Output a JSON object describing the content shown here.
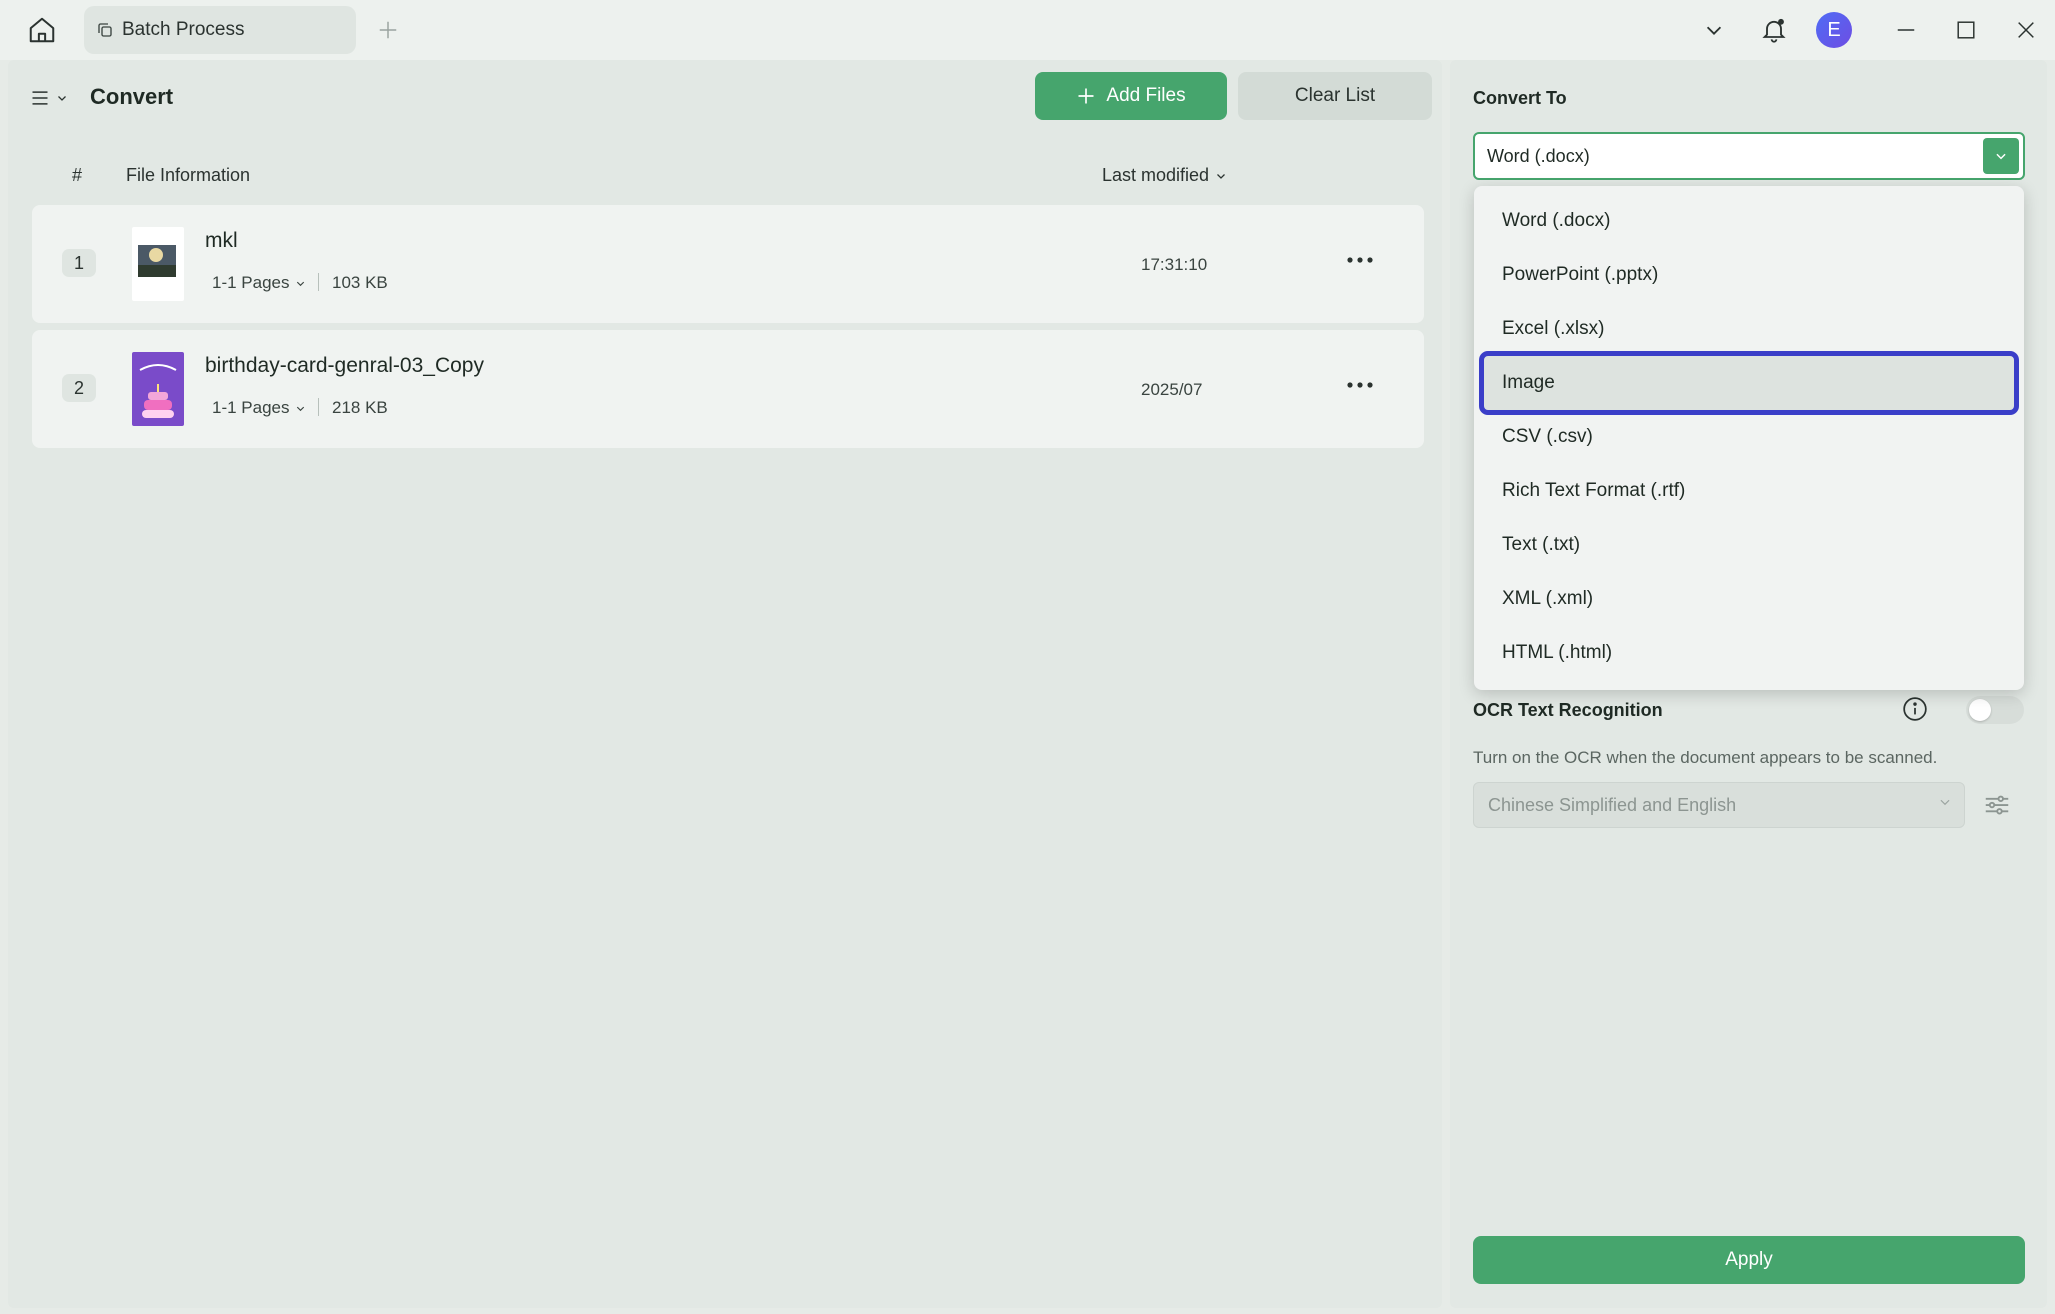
{
  "titlebar": {
    "tab_label": "Batch Process",
    "avatar_letter": "E"
  },
  "convert_panel": {
    "title": "Convert",
    "add_files_label": "Add Files",
    "clear_list_label": "Clear List",
    "columns": {
      "number": "#",
      "file_info": "File Information",
      "last_modified": "Last modified"
    },
    "files": [
      {
        "number": "1",
        "name": "mkl",
        "pages": "1-1 Pages",
        "size": "103 KB",
        "modified": "17:31:10"
      },
      {
        "number": "2",
        "name": "birthday-card-genral-03_Copy",
        "pages": "1-1 Pages",
        "size": "218 KB",
        "modified": "2025/07"
      }
    ]
  },
  "settings_panel": {
    "convert_to_label": "Convert To",
    "selected_format": "Word (.docx)",
    "format_options": [
      "Word (.docx)",
      "PowerPoint (.pptx)",
      "Excel (.xlsx)",
      "Image",
      "CSV (.csv)",
      "Rich Text Format (.rtf)",
      "Text (.txt)",
      "XML (.xml)",
      "HTML (.html)"
    ],
    "highlighted_option": "Image",
    "ocr": {
      "label": "OCR Text Recognition",
      "enabled": false,
      "hint": "Turn on the OCR when the document appears to be scanned.",
      "language": "Chinese Simplified and English"
    },
    "apply_label": "Apply"
  },
  "colors": {
    "accent": "#46a56d",
    "highlight_outline": "#3a3ec8"
  }
}
